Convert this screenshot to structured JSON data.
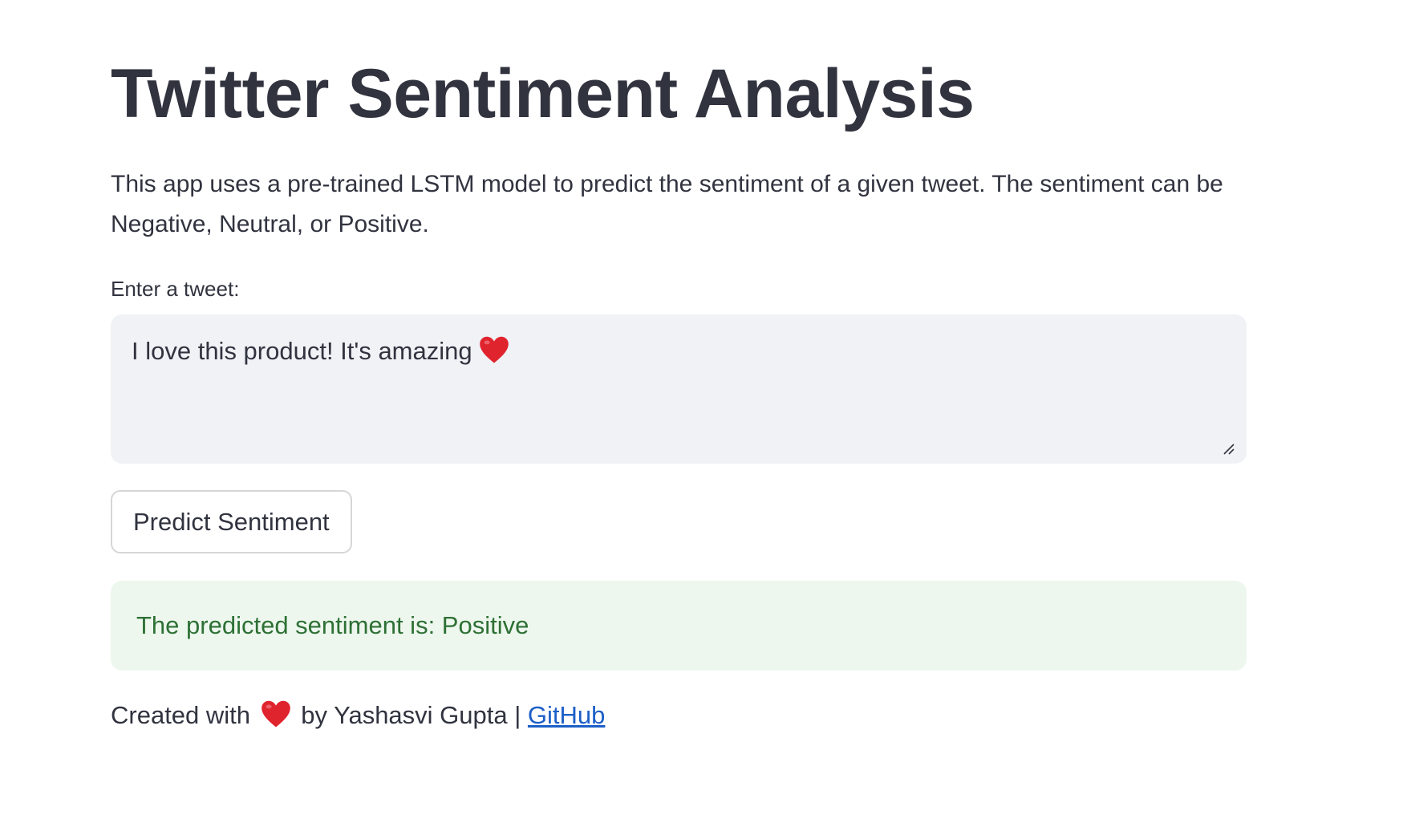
{
  "page": {
    "title": "Twitter Sentiment Analysis",
    "description": "This app uses a pre-trained LSTM model to predict the sentiment of a given tweet. The sentiment can be Negative, Neutral, or Positive."
  },
  "tweet_input": {
    "label": "Enter a tweet:",
    "value": "I love this product! It's amazing"
  },
  "predict_button": {
    "label": "Predict Sentiment"
  },
  "result": {
    "message": "The predicted sentiment is: Positive"
  },
  "footer": {
    "prefix": "Created with",
    "suffix": "by Yashasvi Gupta |",
    "link_label": "GitHub"
  },
  "icons": {
    "heart": "heart-emoji-icon",
    "resize": "resize-grip-icon"
  },
  "colors": {
    "text": "#31333f",
    "input_background": "#f0f2f6",
    "success_background": "#edf7ee",
    "success_text": "#2e7035",
    "link": "#1c5fc7",
    "heart": "#e0242e"
  }
}
